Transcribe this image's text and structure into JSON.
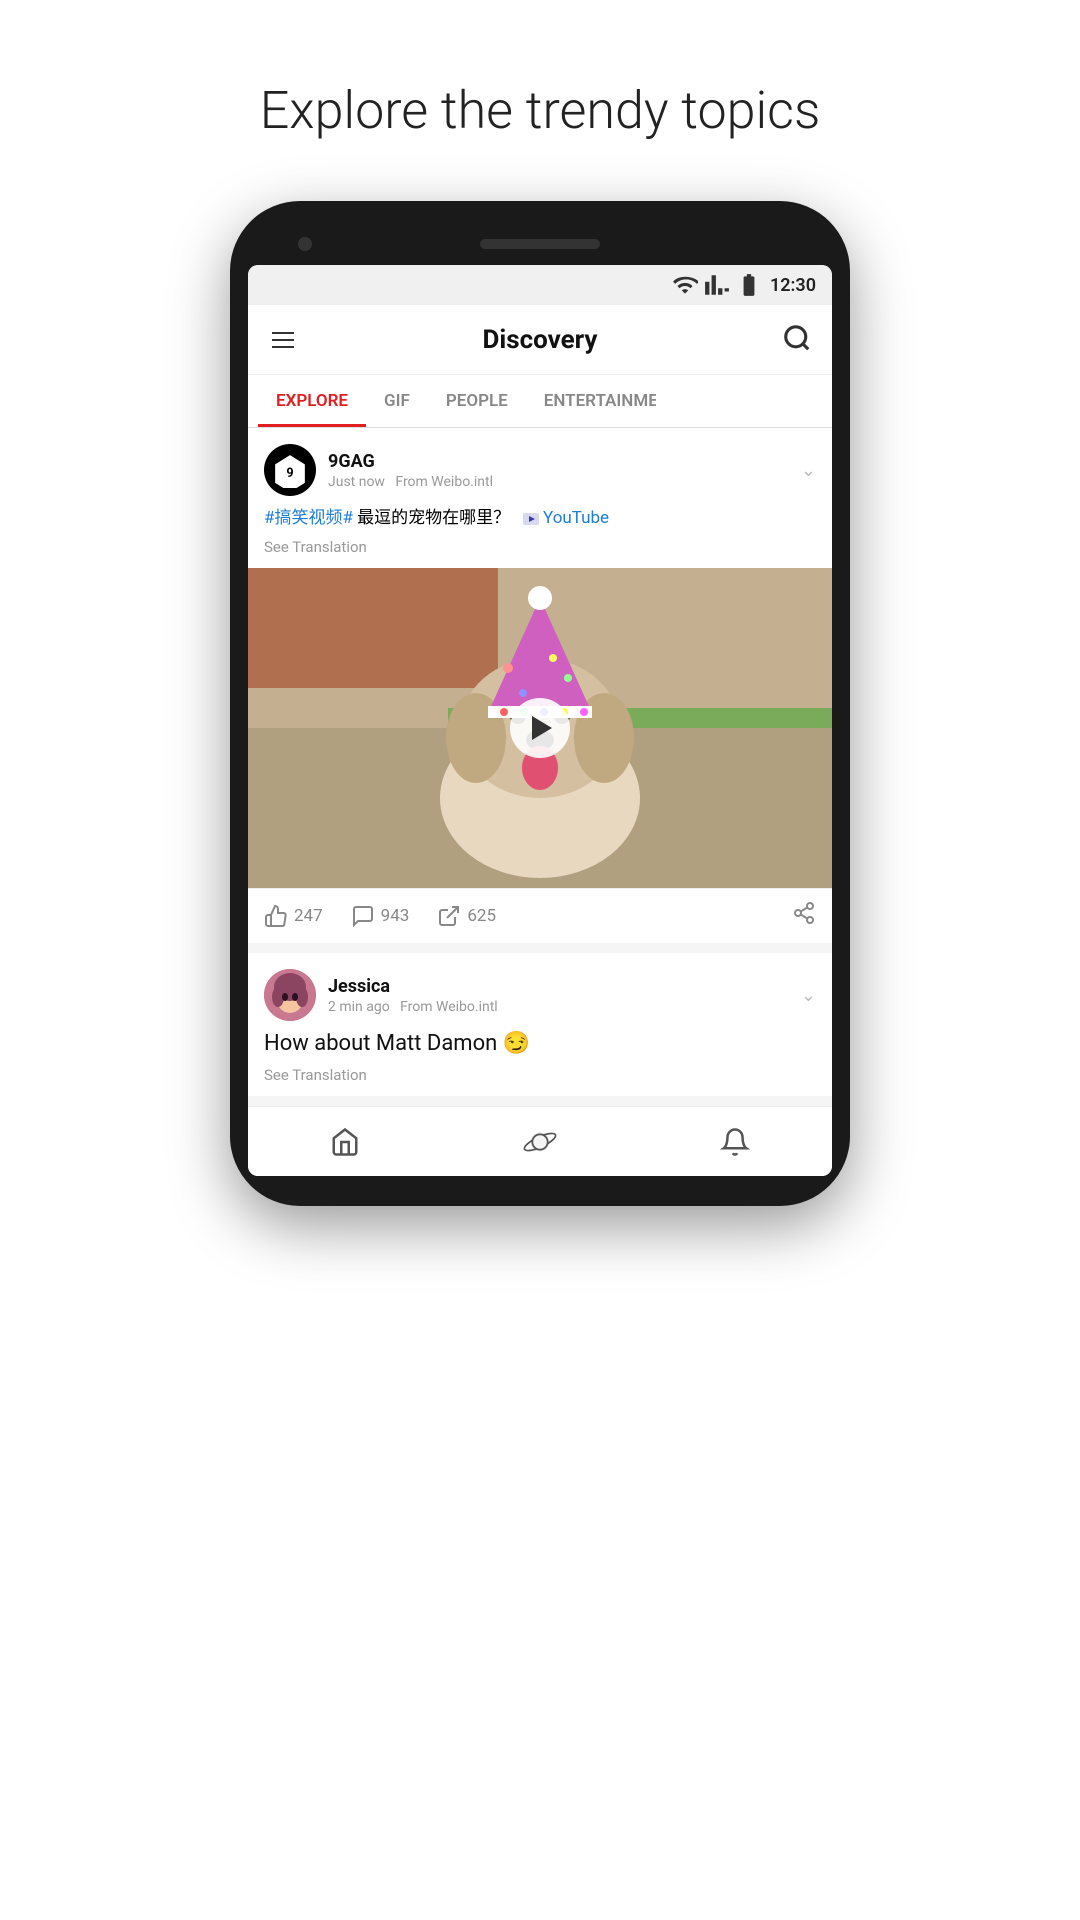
{
  "page": {
    "heading": "Explore the trendy topics"
  },
  "status_bar": {
    "time": "12:30"
  },
  "header": {
    "title": "Discovery",
    "search_label": "search"
  },
  "tabs": [
    {
      "label": "EXPLORE",
      "active": true
    },
    {
      "label": "GIF",
      "active": false
    },
    {
      "label": "PEOPLE",
      "active": false
    },
    {
      "label": "ENTERTAINME...",
      "active": false
    }
  ],
  "posts": [
    {
      "username": "9GAG",
      "time": "Just now",
      "source": "From Weibo.intl",
      "text_part1": "#搞笑视频#",
      "text_part2": " 最逗的宠物在哪里？",
      "text_part3": "YouTube",
      "see_translation": "See Translation",
      "likes": "247",
      "comments": "943",
      "shares": "625"
    },
    {
      "username": "Jessica",
      "time": "2 min ago",
      "source": "From Weibo.intl",
      "text": "How about Matt Damon 😏",
      "see_translation": "See Translation"
    }
  ],
  "bottom_nav": [
    {
      "label": "home",
      "icon": "home"
    },
    {
      "label": "discover",
      "icon": "planet"
    },
    {
      "label": "notifications",
      "icon": "bell"
    }
  ]
}
